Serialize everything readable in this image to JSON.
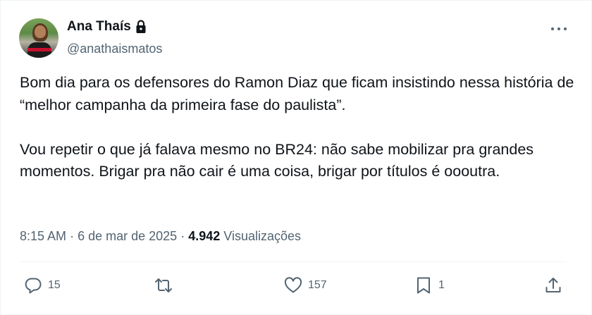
{
  "author": {
    "display_name": "Ana Thaís",
    "handle": "@anathaismatos",
    "protected_icon": "lock-icon",
    "avatar_icon": "profile-photo"
  },
  "tweet": {
    "paragraphs": [
      "Bom dia para os defensores do Ramon Diaz que ficam insistindo nessa história de “melhor campanha da primeira fase do paulista”.",
      "Vou repetir o que já falava mesmo no BR24: não sabe mobilizar pra grandes momentos. Brigar pra não cair é uma coisa, brigar por títulos é oooutra."
    ]
  },
  "meta": {
    "time": "8:15 AM",
    "separator": "·",
    "date": "6 de mar de 2025",
    "views_count": "4.942",
    "views_label": "Visualizações"
  },
  "actions": {
    "reply_count": "15",
    "retweet_count": "",
    "like_count": "157",
    "bookmark_count": "1"
  },
  "colors": {
    "text_primary": "#0f1419",
    "text_secondary": "#536471",
    "border": "#eff3f4"
  }
}
